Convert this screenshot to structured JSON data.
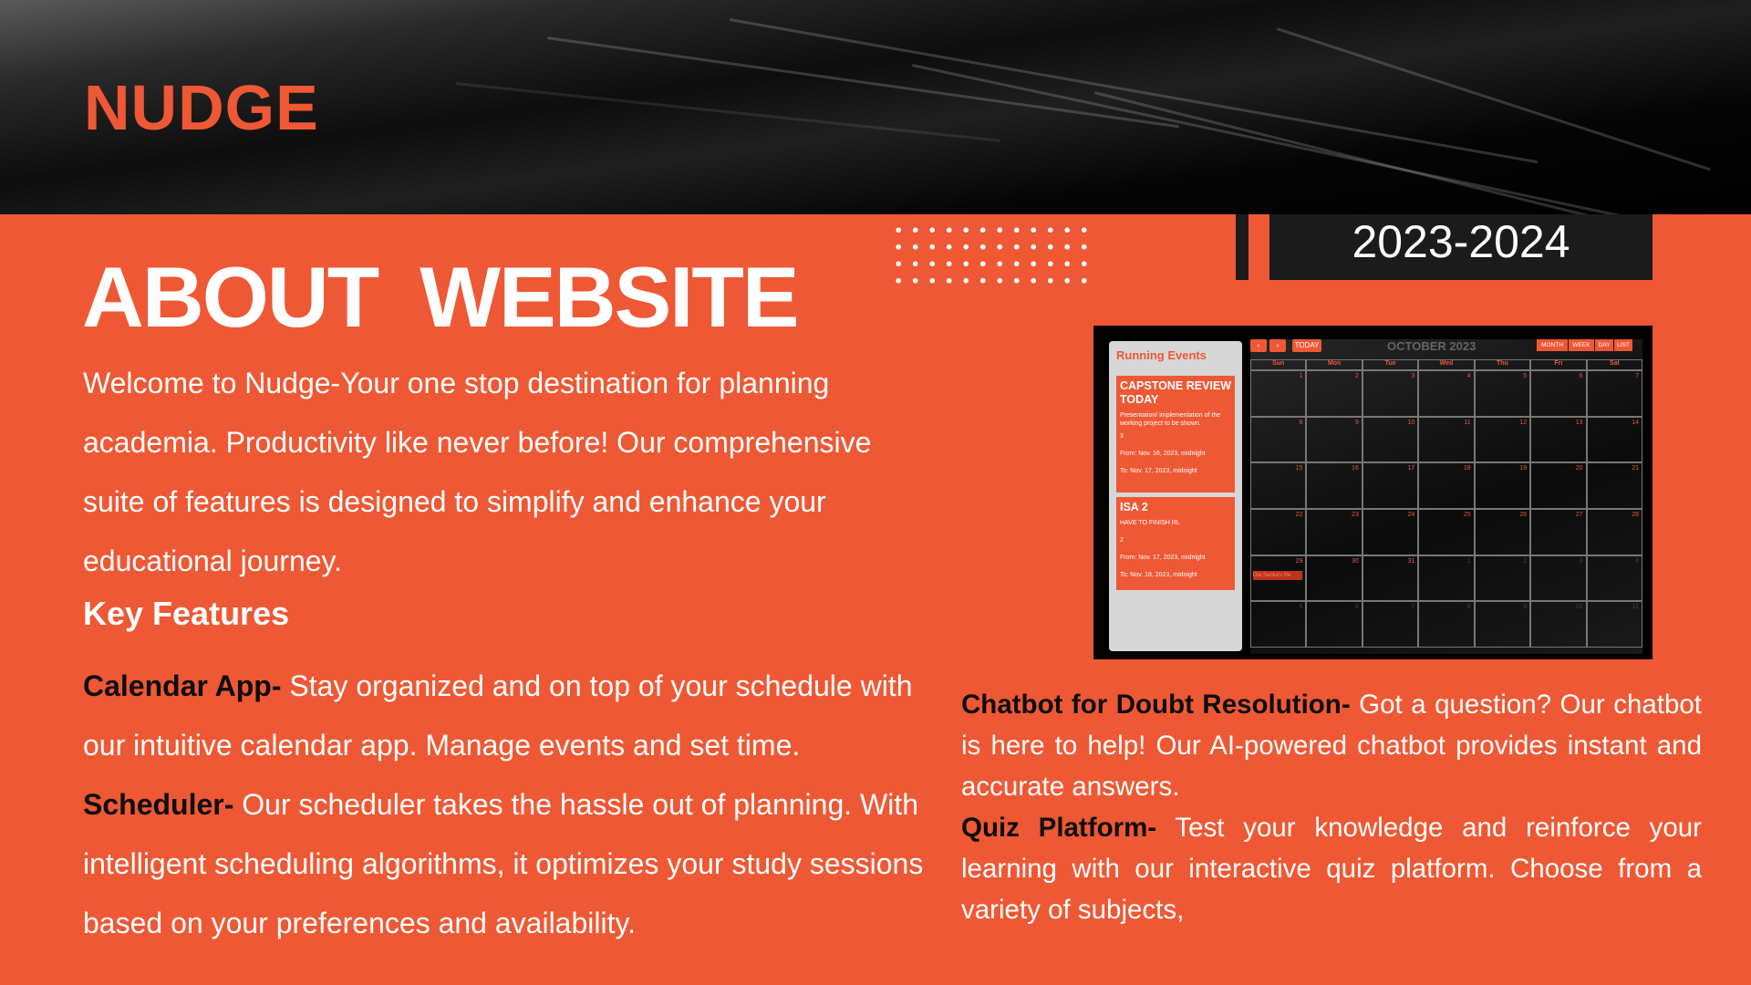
{
  "brand": "NUDGE",
  "title": "ABOUT  WEBSITE",
  "year": "2023-2024",
  "intro": "Welcome to Nudge-Your one stop destination for planning academia. Productivity like never before! Our comprehensive suite of features is designed to simplify and enhance your educational journey.",
  "key_features_heading": "Key Features",
  "features": {
    "calendar": {
      "label": "Calendar App-",
      "text": " Stay organized and on top of your schedule with our intuitive calendar app. Manage events and set time."
    },
    "scheduler": {
      "label": "Scheduler-",
      "text": " Our scheduler takes the hassle out of planning. With intelligent scheduling algorithms, it optimizes your study sessions based on your preferences and availability."
    },
    "chatbot": {
      "label": "Chatbot for Doubt Resolution-",
      "text": " Got a question? Our chatbot is here to help!  Our AI-powered chatbot provides instant and accurate answers."
    },
    "quiz": {
      "label": "Quiz Platform-",
      "text": " Test your knowledge and reinforce your learning with our interactive quiz platform. Choose from a variety of subjects,"
    }
  },
  "calendar_shot": {
    "sidebar_title": "Running Events",
    "events": [
      {
        "title": "CAPSTONE REVIEW TODAY",
        "desc": "Presentation/ implementation of the working project to be shown.",
        "num": "3",
        "from": "From: Nov. 16, 2023, midnight",
        "to": "To: Nov. 17, 2023, midnight"
      },
      {
        "title": "ISA 2",
        "desc": "HAVE TO FINISH RL",
        "num": "2",
        "from": "From: Nov. 17, 2023, midnight",
        "to": "To: Nov. 18, 2023, midnight"
      }
    ],
    "prev": "‹",
    "next": "›",
    "today": "TODAY",
    "month": "OCTOBER 2023",
    "views": [
      "MONTH",
      "WEEK",
      "DAY",
      "LIST"
    ],
    "days_of_week": [
      "Sun",
      "Mon",
      "Tue",
      "Wed",
      "Thu",
      "Fri",
      "Sat"
    ],
    "days": [
      "1",
      "2",
      "3",
      "4",
      "5",
      "6",
      "7",
      "8",
      "9",
      "10",
      "11",
      "12",
      "13",
      "14",
      "15",
      "16",
      "17",
      "18",
      "19",
      "20",
      "21",
      "22",
      "23",
      "24",
      "25",
      "26",
      "27",
      "28",
      "29",
      "30",
      "31",
      "1",
      "2",
      "3",
      "4",
      "5",
      "6",
      "7",
      "8",
      "9",
      "10",
      "11"
    ],
    "event_chip": "Ola Sarika's Re"
  },
  "colors": {
    "accent": "#ef5834",
    "dark": "#1b1b1b"
  }
}
